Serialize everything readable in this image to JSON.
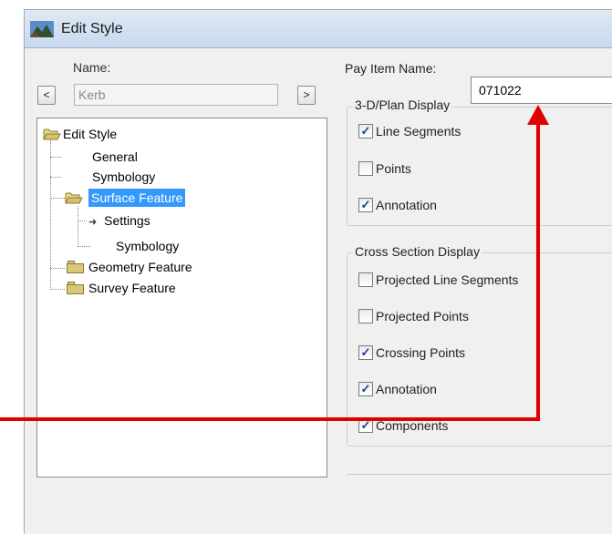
{
  "window": {
    "title": "Edit Style"
  },
  "name": {
    "label": "Name:",
    "value": "Kerb",
    "prev_label": "<",
    "next_label": ">"
  },
  "tree": {
    "root": "Edit Style",
    "items": [
      {
        "label": "General"
      },
      {
        "label": "Symbology"
      },
      {
        "label": "Surface Feature",
        "selected": true
      },
      {
        "label": "Settings",
        "arrow": "➜"
      },
      {
        "label": "Symbology"
      },
      {
        "label": "Geometry Feature"
      },
      {
        "label": "Survey Feature"
      }
    ]
  },
  "pay_item": {
    "label": "Pay Item Name:",
    "value": "071022"
  },
  "plan_display": {
    "title": "3-D/Plan Display",
    "options": [
      {
        "label": "Line Segments",
        "checked": true,
        "mark": "✓"
      },
      {
        "label": "Points",
        "checked": false,
        "mark": ""
      },
      {
        "label": "Annotation",
        "checked": true,
        "mark": "✓"
      }
    ]
  },
  "cross_section": {
    "title": "Cross Section Display",
    "options": [
      {
        "label": "Projected Line Segments",
        "checked": false,
        "mark": ""
      },
      {
        "label": "Projected Points",
        "checked": false,
        "mark": ""
      },
      {
        "label": "Crossing Points",
        "checked": true,
        "mark": "✓"
      },
      {
        "label": "Annotation",
        "checked": true,
        "mark": "✓"
      },
      {
        "label": "Components",
        "checked": true,
        "mark": "✓"
      }
    ]
  },
  "colors": {
    "annotation_red": "#e00000",
    "selection": "#3399ff"
  }
}
